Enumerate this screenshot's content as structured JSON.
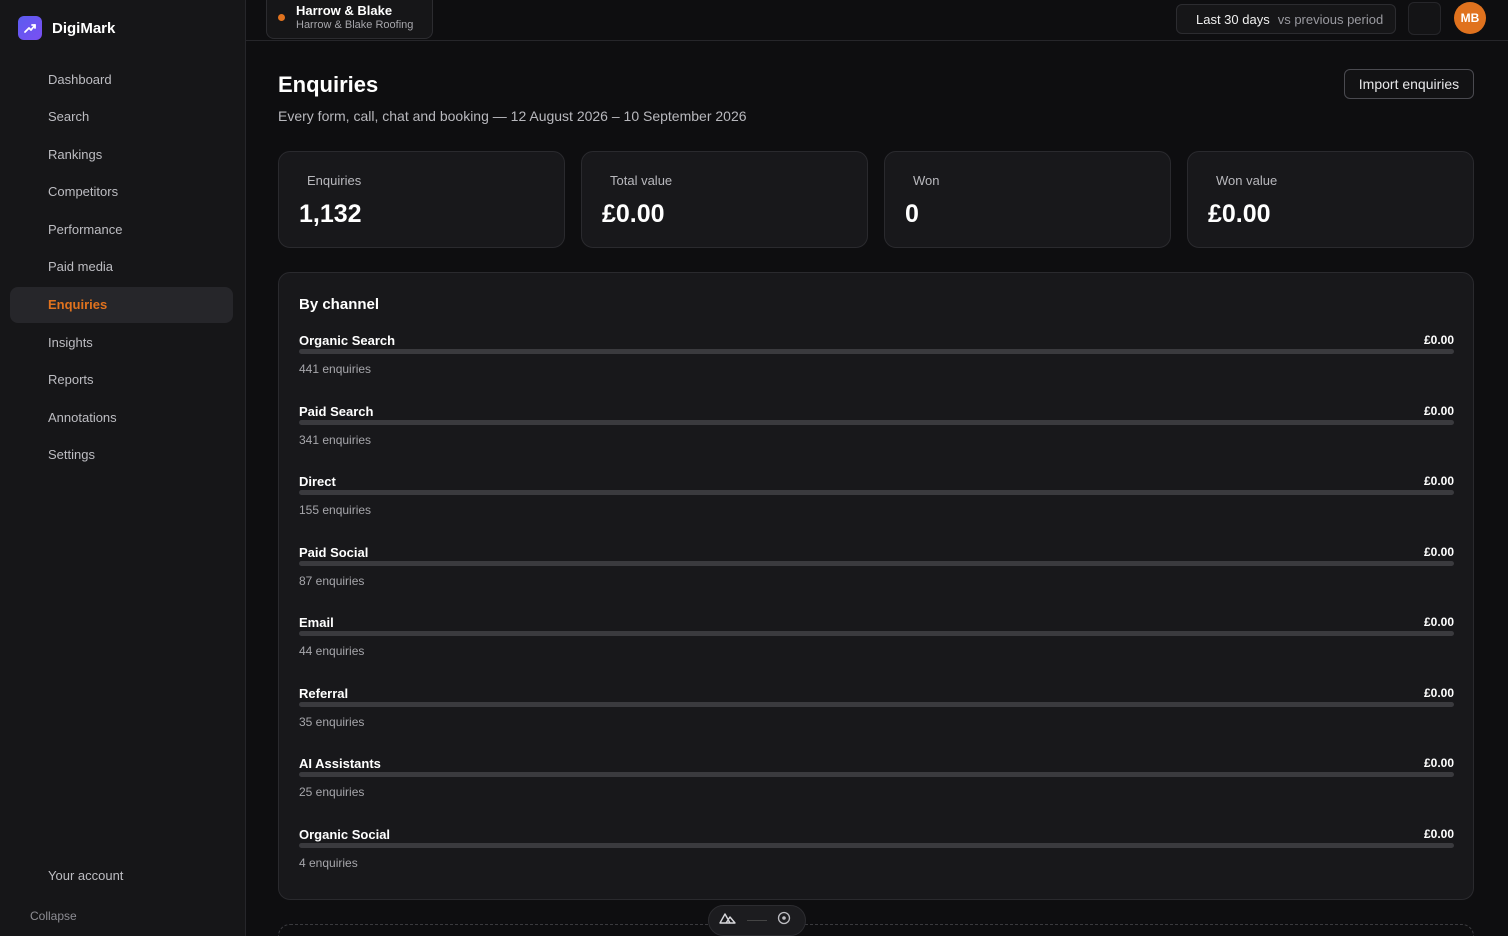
{
  "brand": {
    "name": "DigiMark",
    "icon": "trend-up-icon"
  },
  "sidebar": {
    "items": [
      {
        "label": "Dashboard"
      },
      {
        "label": "Search"
      },
      {
        "label": "Rankings"
      },
      {
        "label": "Competitors"
      },
      {
        "label": "Performance"
      },
      {
        "label": "Paid media"
      },
      {
        "label": "Enquiries",
        "active": true
      },
      {
        "label": "Insights"
      },
      {
        "label": "Reports"
      },
      {
        "label": "Annotations"
      },
      {
        "label": "Settings"
      }
    ],
    "account_label": "Your account",
    "collapse_label": "Collapse"
  },
  "topbar": {
    "client_name": "Harrow & Blake",
    "client_sub": "Harrow & Blake Roofing",
    "period_main": "Last 30 days",
    "period_sub": "vs previous period",
    "avatar_initials": "MB"
  },
  "page": {
    "title": "Enquiries",
    "subtitle": "Every form, call, chat and booking — 12 August 2026 – 10 September 2026",
    "import_label": "Import enquiries"
  },
  "kpis": [
    {
      "label": "Enquiries",
      "value": "1,132"
    },
    {
      "label": "Total value",
      "value": "£0.00"
    },
    {
      "label": "Won",
      "value": "0"
    },
    {
      "label": "Won value",
      "value": "£0.00"
    }
  ],
  "channels": {
    "title": "By channel",
    "rows": [
      {
        "name": "Organic Search",
        "value": "£0.00",
        "count": "441 enquiries",
        "fill": 0
      },
      {
        "name": "Paid Search",
        "value": "£0.00",
        "count": "341 enquiries",
        "fill": 0
      },
      {
        "name": "Direct",
        "value": "£0.00",
        "count": "155 enquiries",
        "fill": 0
      },
      {
        "name": "Paid Social",
        "value": "£0.00",
        "count": "87 enquiries",
        "fill": 0
      },
      {
        "name": "Email",
        "value": "£0.00",
        "count": "44 enquiries",
        "fill": 0
      },
      {
        "name": "Referral",
        "value": "£0.00",
        "count": "35 enquiries",
        "fill": 0
      },
      {
        "name": "AI Assistants",
        "value": "£0.00",
        "count": "25 enquiries",
        "fill": 0
      },
      {
        "name": "Organic Social",
        "value": "£0.00",
        "count": "4 enquiries",
        "fill": 0
      }
    ]
  },
  "colors": {
    "accent": "#e0721e",
    "brand": "#5b5cf0",
    "background": "#0e0e10",
    "card": "#18181b"
  }
}
